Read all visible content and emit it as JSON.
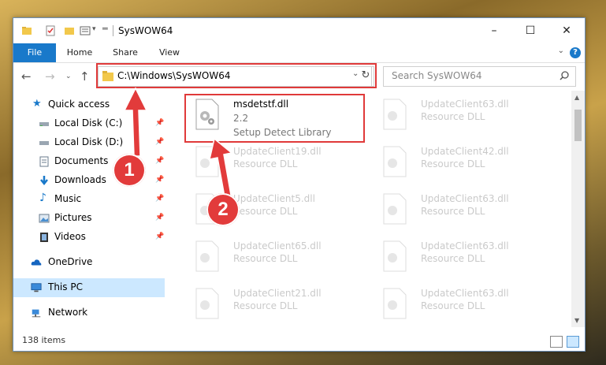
{
  "window": {
    "title": "SysWOW64"
  },
  "ribbon": {
    "tabs": [
      "File",
      "Home",
      "Share",
      "View"
    ],
    "help": "?"
  },
  "address": {
    "path": "C:\\Windows\\SysWOW64"
  },
  "search": {
    "placeholder": "Search SysWOW64"
  },
  "sidebar": {
    "items": [
      {
        "label": "Quick access"
      },
      {
        "label": "Local Disk (C:)"
      },
      {
        "label": "Local Disk (D:)"
      },
      {
        "label": "Documents"
      },
      {
        "label": "Downloads"
      },
      {
        "label": "Music"
      },
      {
        "label": "Pictures"
      },
      {
        "label": "Videos"
      },
      {
        "label": "OneDrive"
      },
      {
        "label": "This PC"
      },
      {
        "label": "Network"
      }
    ]
  },
  "files": {
    "main": {
      "name": "msdetstf.dll",
      "version": "2.2",
      "description": "Setup Detect Library"
    },
    "left": [
      {
        "name": "UpdateClient19.dll",
        "description": "Resource DLL"
      },
      {
        "name": "UpdateClient5.dll",
        "description": "Resource DLL"
      },
      {
        "name": "UpdateClient65.dll",
        "description": "Resource DLL"
      },
      {
        "name": "UpdateClient21.dll",
        "description": "Resource DLL"
      }
    ],
    "right": [
      {
        "name": "UpdateClient63.dll",
        "description": "Resource DLL"
      },
      {
        "name": "UpdateClient42.dll",
        "description": "Resource DLL"
      },
      {
        "name": "UpdateClient63.dll",
        "description": "Resource DLL"
      },
      {
        "name": "UpdateClient63.dll",
        "description": "Resource DLL"
      },
      {
        "name": "UpdateClient63.dll",
        "description": "Resource DLL"
      }
    ]
  },
  "status": {
    "items": "138 items"
  },
  "annotations": {
    "step1": "1",
    "step2": "2"
  },
  "colors": {
    "accent": "#1979ca",
    "highlight": "#e03a3a",
    "selected": "#cce8ff"
  }
}
